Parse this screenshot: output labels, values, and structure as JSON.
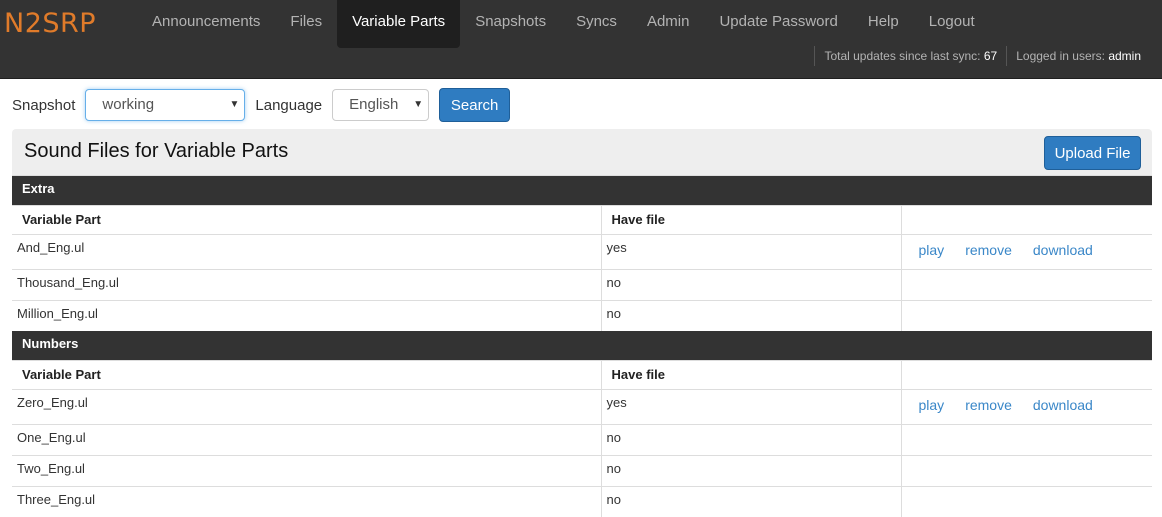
{
  "app": {
    "brand": "N2SRP"
  },
  "nav": {
    "items": [
      "Announcements",
      "Files",
      "Variable Parts",
      "Snapshots",
      "Syncs",
      "Admin",
      "Update Password",
      "Help",
      "Logout"
    ],
    "active": "Variable Parts"
  },
  "status": {
    "updates_label": "Total updates since last sync:",
    "updates_count": "67",
    "users_label": "Logged in users:",
    "users_value": "admin"
  },
  "toolbar": {
    "snapshot_label": "Snapshot",
    "snapshot_value": "working",
    "language_label": "Language",
    "language_value": "English",
    "search_label": "Search"
  },
  "panel": {
    "title": "Sound Files for Variable Parts",
    "upload_label": "Upload File"
  },
  "table": {
    "col_variable_part": "Variable Part",
    "col_have_file": "Have file",
    "action_play": "play",
    "action_remove": "remove",
    "action_download": "download",
    "sections": [
      {
        "name": "Extra",
        "rows": [
          {
            "part": "And_Eng.ul",
            "have": "yes"
          },
          {
            "part": "Thousand_Eng.ul",
            "have": "no"
          },
          {
            "part": "Million_Eng.ul",
            "have": "no"
          }
        ]
      },
      {
        "name": "Numbers",
        "rows": [
          {
            "part": "Zero_Eng.ul",
            "have": "yes"
          },
          {
            "part": "One_Eng.ul",
            "have": "no"
          },
          {
            "part": "Two_Eng.ul",
            "have": "no"
          },
          {
            "part": "Three_Eng.ul",
            "have": "no"
          }
        ]
      }
    ]
  },
  "colors": {
    "navbar": "#333333",
    "brand": "#e07b2a",
    "primary": "#2f7cc1",
    "link": "#3a87c8"
  }
}
